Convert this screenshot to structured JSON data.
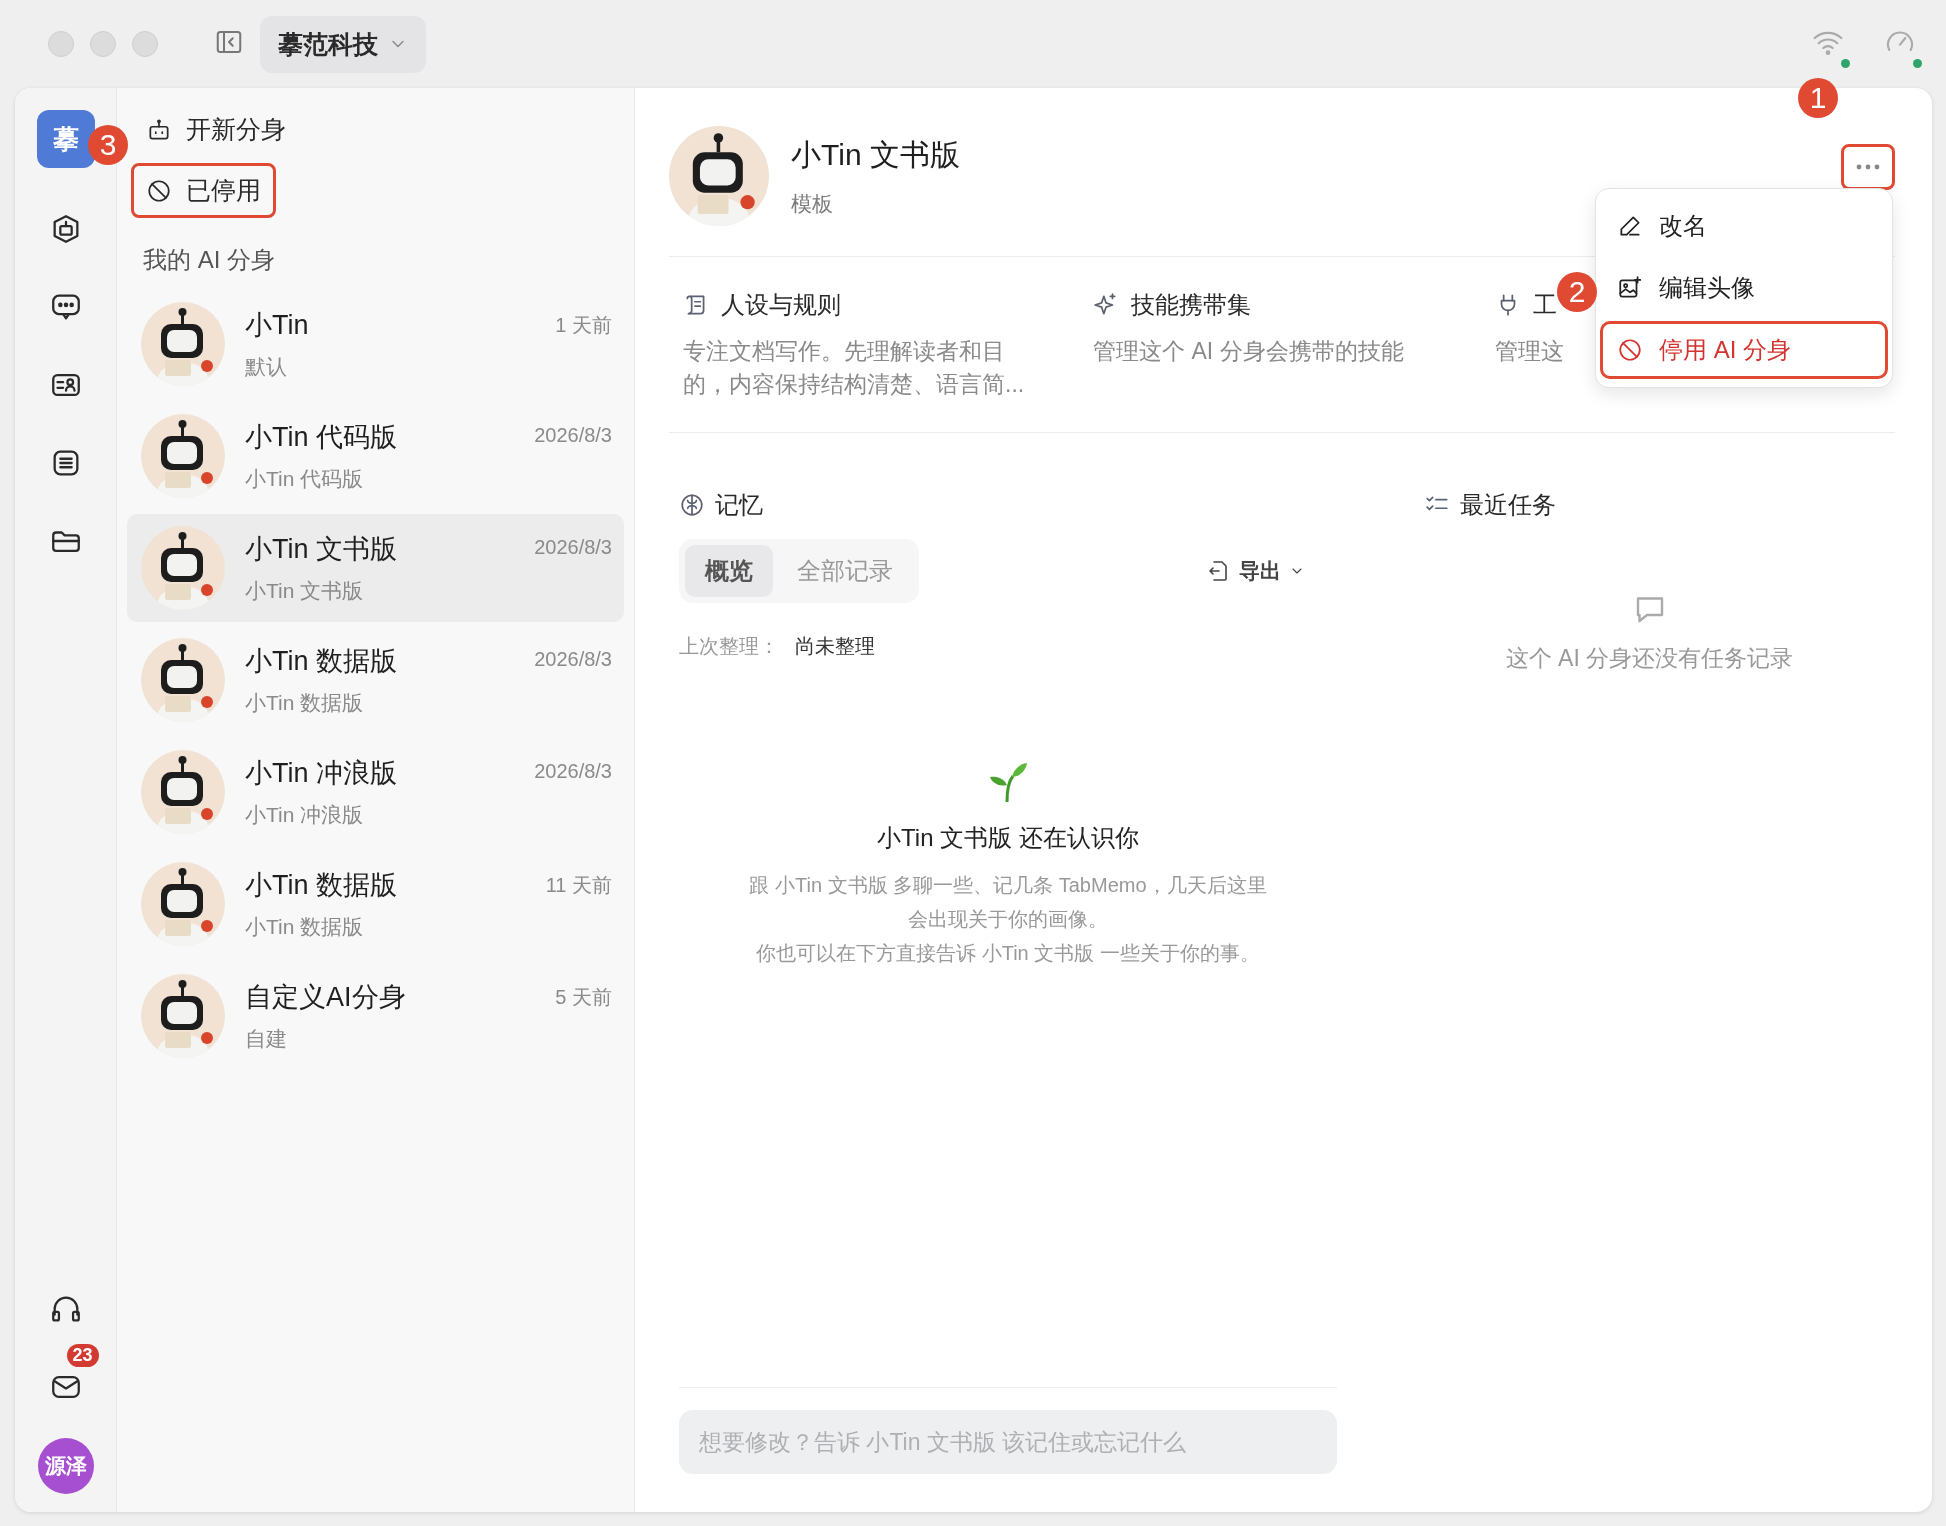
{
  "titlebar": {
    "workspace": "摹范科技"
  },
  "rail": {
    "workspace_initial": "摹",
    "mail_badge": "23",
    "user": "源泽"
  },
  "list_panel": {
    "new_button": "开新分身",
    "disabled_filter": {
      "label": "已停用",
      "highlighted": true
    },
    "section_title": "我的 AI 分身",
    "items": [
      {
        "name": "小Tin",
        "subtitle": "默认",
        "time": "1 天前",
        "selected": false
      },
      {
        "name": "小Tin 代码版",
        "subtitle": "小Tin 代码版",
        "time": "2026/8/3",
        "selected": false
      },
      {
        "name": "小Tin 文书版",
        "subtitle": "小Tin 文书版",
        "time": "2026/8/3",
        "selected": true
      },
      {
        "name": "小Tin 数据版",
        "subtitle": "小Tin 数据版",
        "time": "2026/8/3",
        "selected": false
      },
      {
        "name": "小Tin 冲浪版",
        "subtitle": "小Tin 冲浪版",
        "time": "2026/8/3",
        "selected": false
      },
      {
        "name": "小Tin 数据版",
        "subtitle": "小Tin 数据版",
        "time": "11 天前",
        "selected": false
      },
      {
        "name": "自定义AI分身",
        "subtitle": "自建",
        "time": "5 天前",
        "selected": false
      }
    ]
  },
  "detail": {
    "title": "小Tin 文书版",
    "subtitle": "模板",
    "more_button": {
      "highlighted": true
    },
    "cards": [
      {
        "kind": "rules",
        "title": "人设与规则",
        "description": "专注文档写作。先理解读者和目的，内容保持结构清楚、语言简..."
      },
      {
        "kind": "skills",
        "title": "技能携带集",
        "description": "管理这个 AI 分身会携带的技能"
      },
      {
        "kind": "tools",
        "title": "工",
        "description": "管理这"
      }
    ],
    "memory": {
      "title": "记忆",
      "tabs": [
        {
          "label": "概览",
          "selected": true
        },
        {
          "label": "全部记录",
          "selected": false
        }
      ],
      "export": "导出",
      "last_label": "上次整理：",
      "last_value": "尚未整理",
      "empty_title": "小Tin 文书版 还在认识你",
      "empty_lines": [
        "跟 小Tin 文书版 多聊一些、记几条 TabMemo，几天后这里",
        "会出现关于你的画像。",
        "你也可以在下方直接告诉 小Tin 文书版 一些关于你的事。"
      ]
    },
    "tasks": {
      "title": "最近任务",
      "empty": "这个 AI 分身还没有任务记录"
    },
    "input": {
      "placeholder": "想要修改？告诉 小Tin 文书版 该记住或忘记什么"
    }
  },
  "menu": {
    "items": [
      {
        "kind": "rename",
        "label": "改名",
        "danger": false,
        "highlighted": false
      },
      {
        "kind": "avatar",
        "label": "编辑头像",
        "danger": false,
        "highlighted": false
      },
      {
        "kind": "disable",
        "label": "停用 AI 分身",
        "danger": true,
        "highlighted": true
      }
    ]
  },
  "callouts": [
    {
      "label": "1"
    },
    {
      "label": "2"
    },
    {
      "label": "3"
    }
  ]
}
